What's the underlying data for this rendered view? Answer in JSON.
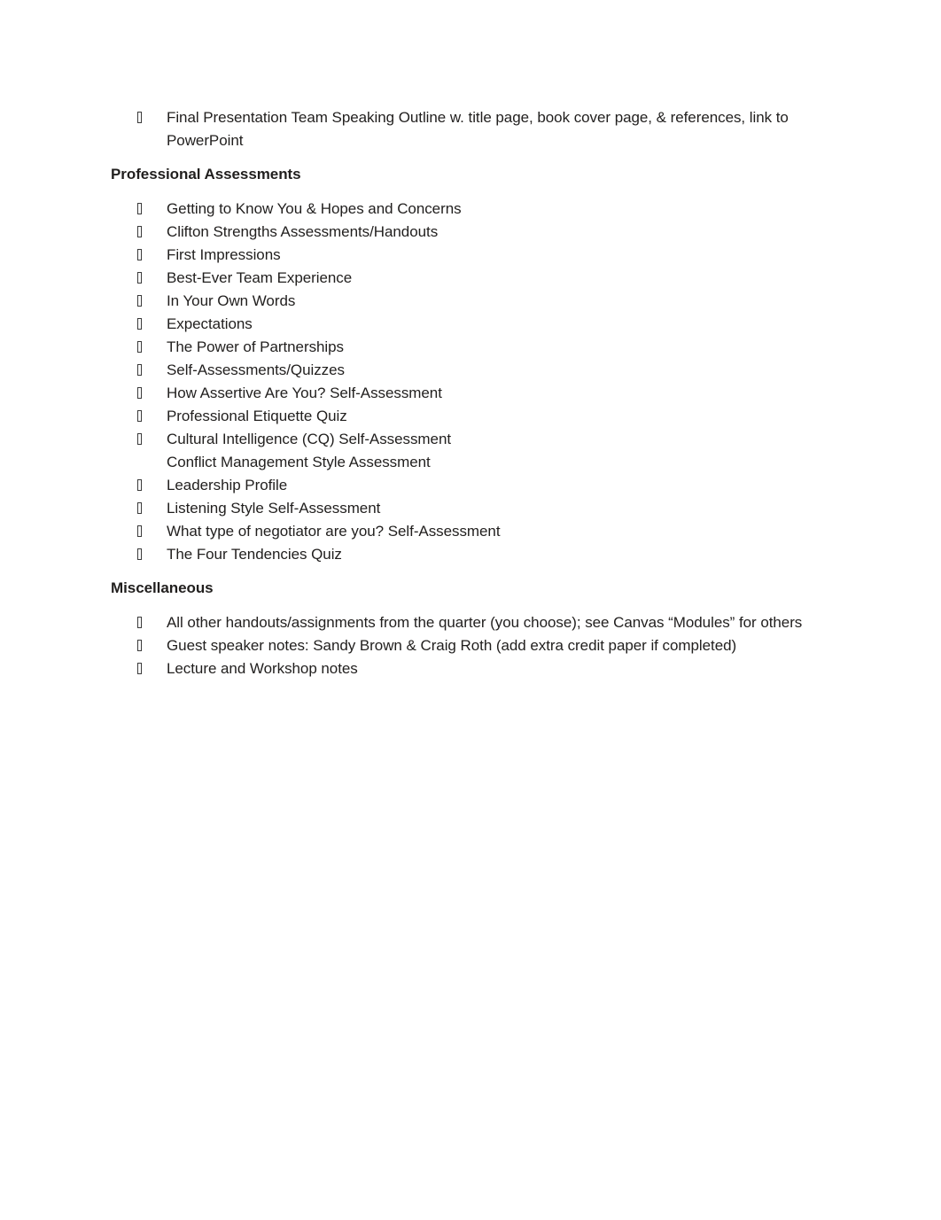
{
  "document": {
    "lead_list": {
      "items": [
        {
          "bullet": "missing-glyph-box",
          "text": "Final Presentation Team Speaking Outline w. title page, book cover page, & references, link to PowerPoint"
        }
      ]
    },
    "sections": [
      {
        "heading": "Professional Assessments",
        "items": [
          {
            "bullet": "missing-glyph-box",
            "text": "Getting to Know You & Hopes and Concerns"
          },
          {
            "bullet": "missing-glyph-box",
            "text": "Clifton Strengths Assessments/Handouts"
          },
          {
            "bullet": "missing-glyph-box",
            "text": "First Impressions"
          },
          {
            "bullet": "missing-glyph-box",
            "text": "Best-Ever Team Experience"
          },
          {
            "bullet": "missing-glyph-box",
            "text": "In Your Own Words"
          },
          {
            "bullet": "missing-glyph-box",
            "text": "Expectations"
          },
          {
            "bullet": "missing-glyph-box",
            "text": "The Power of Partnerships"
          },
          {
            "bullet": "missing-glyph-box",
            "text": "Self-Assessments/Quizzes"
          },
          {
            "bullet": "missing-glyph-box",
            "text": "How Assertive Are You? Self-Assessment"
          },
          {
            "bullet": "missing-glyph-box",
            "text": "Professional Etiquette Quiz"
          },
          {
            "bullet": "missing-glyph-box",
            "text": "Cultural Intelligence (CQ) Self-Assessment",
            "continuation": "Conflict Management Style Assessment"
          },
          {
            "bullet": "missing-glyph-box",
            "text": "Leadership Profile"
          },
          {
            "bullet": "missing-glyph-box",
            "text": "Listening Style Self-Assessment"
          },
          {
            "bullet": "missing-glyph-box",
            "text": "What type of negotiator are you? Self-Assessment"
          },
          {
            "bullet": "missing-glyph-box",
            "text": "The Four Tendencies Quiz"
          }
        ]
      },
      {
        "heading": "Miscellaneous",
        "items": [
          {
            "bullet": "missing-glyph-box",
            "text": "All other handouts/assignments from the quarter (you choose); see Canvas “Modules” for others"
          },
          {
            "bullet": "missing-glyph-box",
            "text": "Guest speaker notes: Sandy Brown & Craig Roth (add extra credit paper if completed)"
          },
          {
            "bullet": "missing-glyph-box",
            "text": "Lecture and Workshop notes"
          }
        ]
      }
    ]
  },
  "style": {
    "text_color": "#211f1e",
    "page_background": "#ffffff"
  }
}
